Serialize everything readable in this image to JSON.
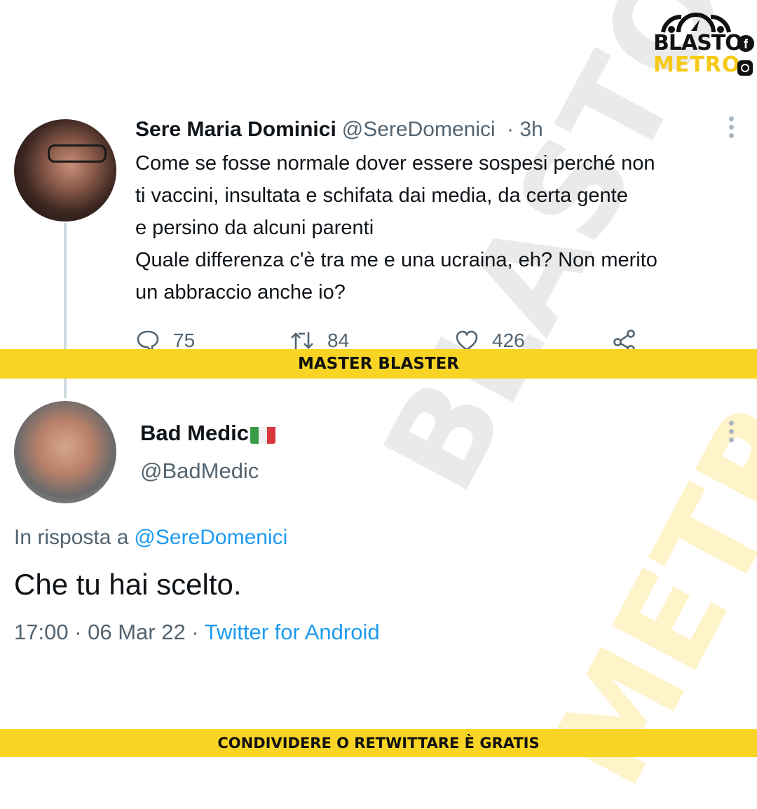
{
  "brand": {
    "line1": "BLASTO",
    "line2": "METRO",
    "facebook_icon": "facebook-icon",
    "instagram_icon": "instagram-icon",
    "accent": "#f8d524"
  },
  "tweet1": {
    "name": "Sere Maria Dominici",
    "handle": "@SereDomenici",
    "time": "· 3h",
    "body_lines": [
      "Come se fosse normale dover essere sospesi perché non",
      "ti vaccini, insultata e schifata dai media, da  certa gente",
      "e persino da alcuni parenti",
      "Quale differenza c'è tra me e una ucraina, eh? Non merito",
      "un abbraccio anche io?"
    ],
    "replies": "75",
    "retweets": "84",
    "likes": "426"
  },
  "banner_top": "MASTER BLASTER",
  "tweet2": {
    "name": "Bad Medic",
    "handle": "@BadMedic",
    "reply_prefix": "In risposta a",
    "reply_to": "@SereDomenici",
    "text": "Che tu hai scelto.",
    "time": "17:00",
    "date": "06 Mar 22",
    "source": "Twitter for Android"
  },
  "banner_bottom": "CONDIVIDERE O RETWITTARE È GRATIS",
  "watermark": {
    "word1": "BLASTO",
    "word2": "METRO"
  },
  "colors": {
    "text": "#0f1419",
    "muted": "#536471",
    "link": "#1d9bf0",
    "banner": "#f8d524"
  }
}
